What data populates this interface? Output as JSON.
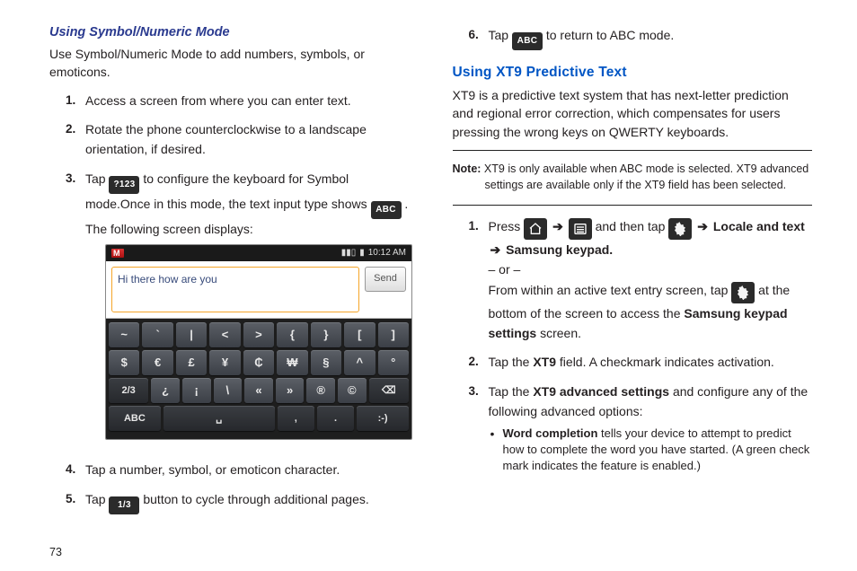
{
  "left": {
    "heading": "Using Symbol/Numeric Mode",
    "intro": "Use Symbol/Numeric Mode to add numbers, symbols, or emoticons.",
    "s1": "Access a screen from where you can enter text.",
    "s2": "Rotate the phone counterclockwise to a landscape orientation, if desired.",
    "s3a": "Tap ",
    "s3chip": "?123",
    "s3b": " to configure the keyboard for Symbol mode.Once in this mode, the text input type shows ",
    "s3chip2": "ABC",
    "s3c": " . The following screen displays:",
    "s4": "Tap a number, symbol, or emoticon character.",
    "s5a": "Tap ",
    "s5chip": "1/3",
    "s5b": " button to cycle through additional pages."
  },
  "phone": {
    "time": "10:12 AM",
    "text": "Hi there how are you",
    "send": "Send",
    "row1": [
      "~",
      "`",
      "|",
      "<",
      ">",
      "{",
      "}",
      "[",
      "]"
    ],
    "row2": [
      "$",
      "€",
      "£",
      "¥",
      "₵",
      "₩",
      "§",
      "^",
      "°"
    ],
    "row3": [
      "2/3",
      "¿",
      "¡",
      "\\",
      "«",
      "»",
      "®",
      "©",
      "⌫"
    ],
    "row4": [
      "ABC",
      "␣",
      ",",
      ".",
      ":-)"
    ]
  },
  "right": {
    "s6a": "Tap ",
    "s6chip": "ABC",
    "s6b": " to return to ABC mode.",
    "heading": "Using XT9 Predictive Text",
    "intro": "XT9 is a predictive text system that has next-letter prediction and regional error correction, which compensates for users pressing the wrong keys on QWERTY keyboards.",
    "noteLabel": "Note:",
    "note": " XT9 is only available when ABC mode is selected. XT9 advanced settings are available only if the XT9 field has been selected.",
    "r1a": "Press ",
    "r1b": " and then tap ",
    "arrow": "➔",
    "locale": "Locale and text",
    "kpLine": "Samsung keypad.",
    "or": "– or –",
    "r1c": "From within an active text entry screen, tap ",
    "r1d": " at the bottom of the screen to access the ",
    "kpSettings": "Samsung keypad settings",
    "screen": " screen.",
    "r2a": "Tap the ",
    "xt9": "XT9",
    "r2b": " field. A checkmark indicates activation.",
    "r3a": "Tap the ",
    "xt9adv": "XT9 advanced settings",
    "r3b": " and configure any of the following advanced options:",
    "bulletLead": "Word completion",
    "bullet": " tells your device to attempt to predict how to complete the word you have started. (A green check mark indicates the feature is enabled.)"
  },
  "pageNum": "73"
}
